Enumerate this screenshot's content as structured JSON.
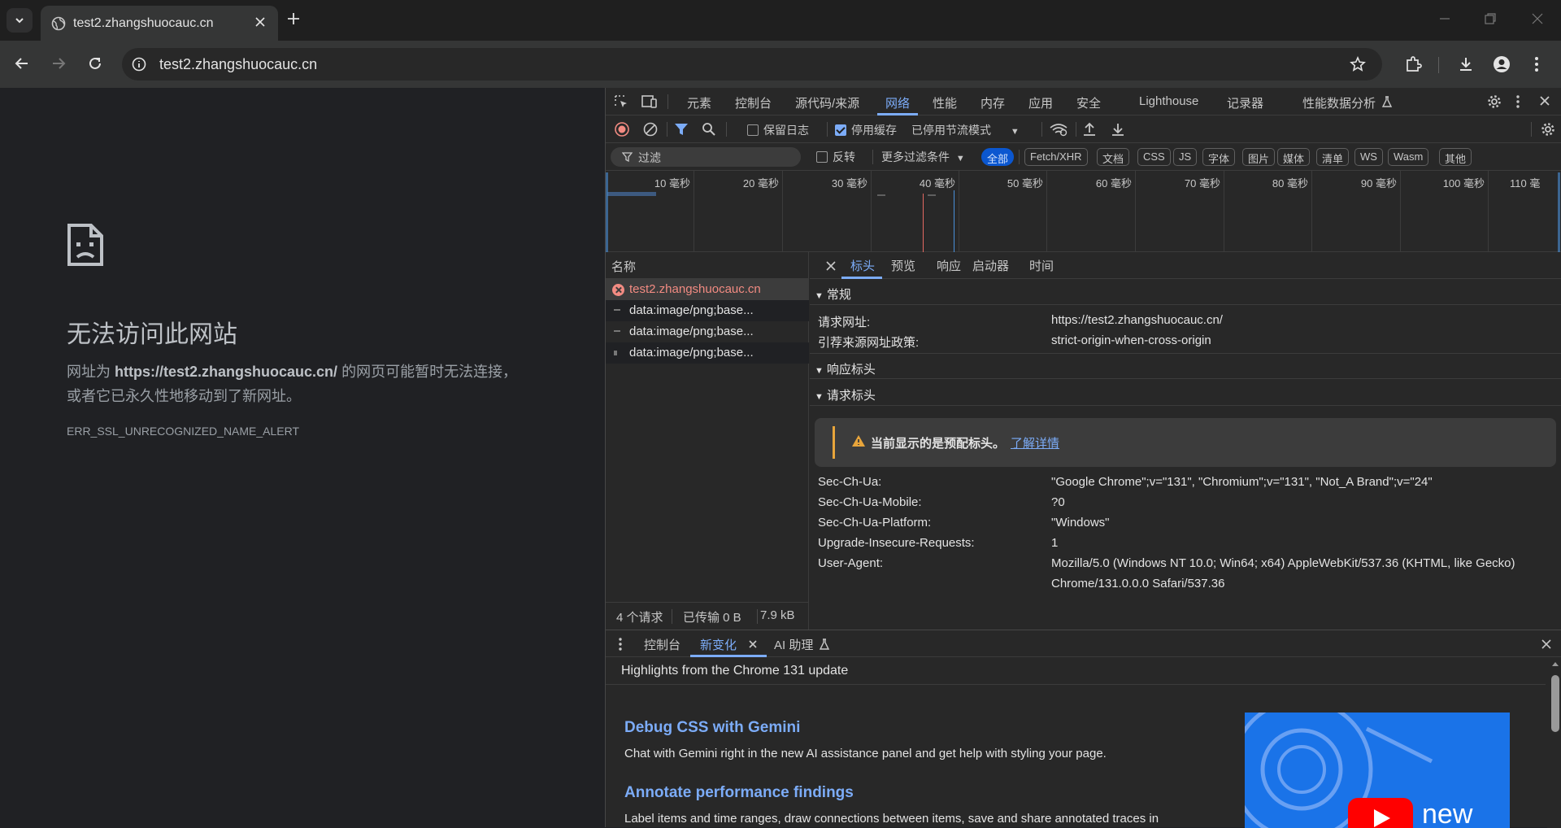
{
  "browser": {
    "tab_title": "test2.zhangshuocauc.cn",
    "url": "test2.zhangshuocauc.cn"
  },
  "error_page": {
    "heading": "无法访问此网站",
    "message_prefix": "网址为 ",
    "message_url": "https://test2.zhangshuocauc.cn/",
    "message_suffix": " 的网页可能暂时无法连接，",
    "message_line2": "或者它已永久性地移动到了新网址。",
    "error_code": "ERR_SSL_UNRECOGNIZED_NAME_ALERT"
  },
  "devtools": {
    "tabs": [
      "元素",
      "控制台",
      "源代码/来源",
      "网络",
      "性能",
      "内存",
      "应用",
      "安全",
      "Lighthouse",
      "记录器",
      "性能数据分析"
    ],
    "active_tab": "网络",
    "network_toolbar": {
      "preserve_log": "保留日志",
      "disable_cache": "停用缓存",
      "throttling": "已停用节流模式"
    },
    "filter": {
      "placeholder": "过滤",
      "invert": "反转",
      "more_filters": "更多过滤条件",
      "chips": [
        "全部",
        "Fetch/XHR",
        "文档",
        "CSS",
        "JS",
        "字体",
        "图片",
        "媒体",
        "清单",
        "WS",
        "Wasm",
        "其他"
      ]
    },
    "timeline_labels": [
      "10 毫秒",
      "20 毫秒",
      "30 毫秒",
      "40 毫秒",
      "50 毫秒",
      "60 毫秒",
      "70 毫秒",
      "80 毫秒",
      "90 毫秒",
      "100 毫秒",
      "110 毫"
    ],
    "request_list": {
      "header": "名称",
      "requests": [
        "test2.zhangshuocauc.cn",
        "data:image/png;base...",
        "data:image/png;base...",
        "data:image/png;base..."
      ],
      "status": {
        "requests": "4 个请求",
        "transferred": "已传输 0 B",
        "resources": "7.9 kB"
      }
    },
    "details": {
      "tabs": [
        "标头",
        "预览",
        "响应",
        "启动器",
        "时间"
      ],
      "active_tab": "标头",
      "general_section": "常规",
      "general": [
        {
          "key": "请求网址:",
          "value": "https://test2.zhangshuocauc.cn/"
        },
        {
          "key": "引荐来源网址政策:",
          "value": "strict-origin-when-cross-origin"
        }
      ],
      "response_headers_section": "响应标头",
      "request_headers_section": "请求标头",
      "warning_text": "当前显示的是预配标头。",
      "warning_link": "了解详情",
      "request_headers": [
        {
          "key": "Sec-Ch-Ua:",
          "value": "\"Google Chrome\";v=\"131\", \"Chromium\";v=\"131\", \"Not_A Brand\";v=\"24\""
        },
        {
          "key": "Sec-Ch-Ua-Mobile:",
          "value": "?0"
        },
        {
          "key": "Sec-Ch-Ua-Platform:",
          "value": "\"Windows\""
        },
        {
          "key": "Upgrade-Insecure-Requests:",
          "value": "1"
        },
        {
          "key": "User-Agent:",
          "value": "Mozilla/5.0 (Windows NT 10.0; Win64; x64) AppleWebKit/537.36 (KHTML, like Gecko)"
        },
        {
          "key": "",
          "value": "Chrome/131.0.0.0 Safari/537.36"
        }
      ]
    },
    "drawer": {
      "tabs": [
        "控制台",
        "新变化",
        "AI 助理"
      ],
      "active_tab": "新变化",
      "subtitle": "Highlights from the Chrome 131 update",
      "features": [
        {
          "title": "Debug CSS with Gemini",
          "text": "Chat with Gemini right in the new AI assistance panel and get help with styling your page."
        },
        {
          "title": "Annotate performance findings",
          "text": "Label items and time ranges, draw connections between items, save and share annotated traces in"
        }
      ],
      "promo_text": "new"
    }
  },
  "colors": {
    "accent": "#7cacf8",
    "error": "#f28b82",
    "warning": "#e8a53b"
  }
}
